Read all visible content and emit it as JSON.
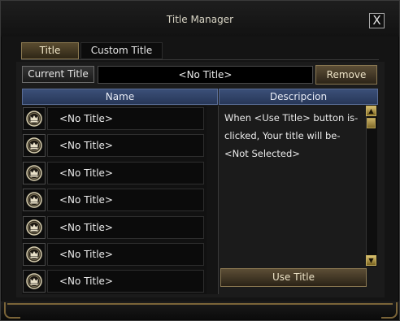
{
  "window": {
    "title": "Title Manager",
    "close_label": "X"
  },
  "tabs": [
    {
      "label": "Title",
      "active": true
    },
    {
      "label": "Custom Title",
      "active": false
    }
  ],
  "current": {
    "label": "Current Title",
    "value": "<No Title>",
    "remove_label": "Remove"
  },
  "columns": {
    "name": "Name",
    "description": "Descripcion"
  },
  "titles": [
    {
      "name": "<No Title>",
      "icon": "crown-icon"
    },
    {
      "name": "<No Title>",
      "icon": "crown-icon"
    },
    {
      "name": "<No Title>",
      "icon": "crown-icon"
    },
    {
      "name": "<No Title>",
      "icon": "crown-icon"
    },
    {
      "name": "<No Title>",
      "icon": "crown-icon"
    },
    {
      "name": "<No Title>",
      "icon": "crown-icon"
    },
    {
      "name": "<No Title>",
      "icon": "crown-icon"
    }
  ],
  "description": {
    "text": "When <Use Title> button is-\nclicked, Your title will be-\n<Not Selected>"
  },
  "actions": {
    "use_title_label": "Use Title"
  },
  "colors": {
    "header_blue": "#2f4268",
    "gold_accent": "#c8b060",
    "button_bronze": "#5c4e36"
  }
}
